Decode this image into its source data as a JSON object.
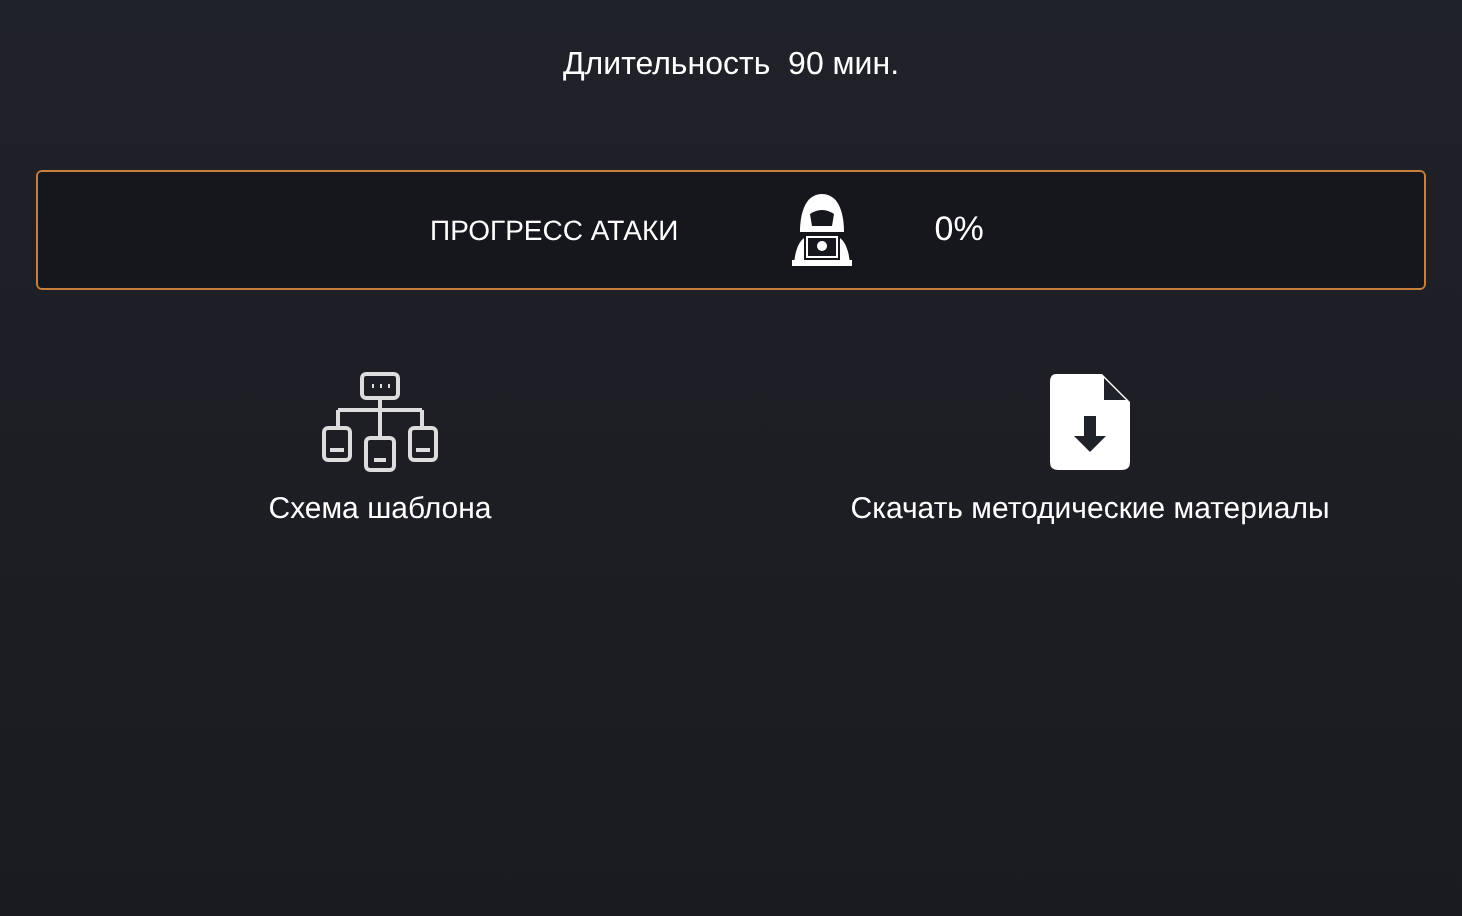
{
  "duration": {
    "label": "Длительность",
    "value": "90 мин."
  },
  "progress": {
    "label": "ПРОГРЕСС АТАКИ",
    "reading": "0%"
  },
  "actions": [
    {
      "kind": "scheme",
      "label": "Схема шаблона"
    },
    {
      "kind": "download",
      "label": "Скачать методические материалы"
    }
  ]
}
